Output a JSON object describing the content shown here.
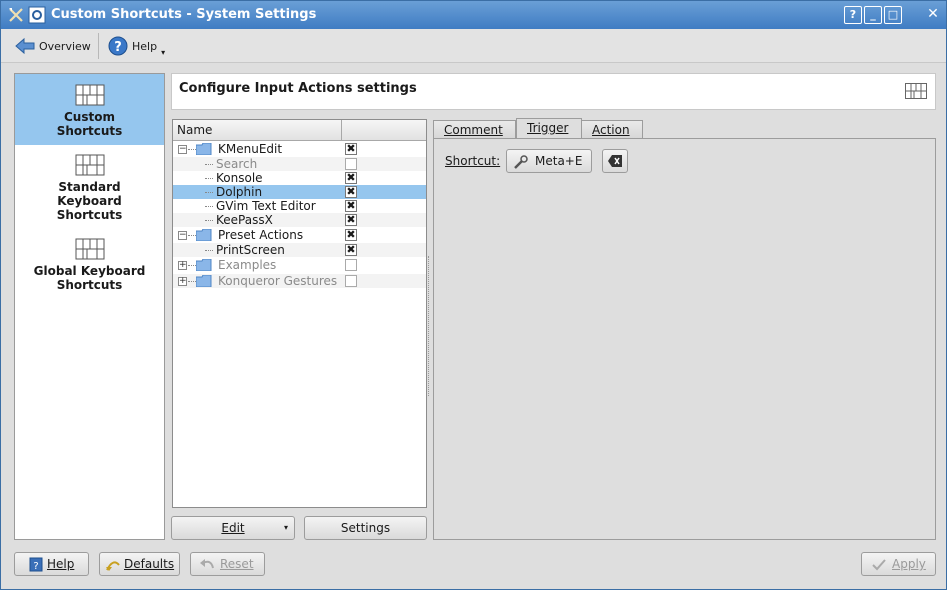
{
  "window": {
    "title": "Custom Shortcuts - System Settings"
  },
  "titlebar_buttons": [
    "?",
    "_",
    "□",
    "✕"
  ],
  "toolbar": {
    "overview_label": "Overview",
    "help_label": "Help"
  },
  "sidebar": {
    "items": [
      {
        "line1": "Custom",
        "line2": "Shortcuts",
        "line3": ""
      },
      {
        "line1": "Standard",
        "line2": "Keyboard",
        "line3": "Shortcuts"
      },
      {
        "line1": "Global Keyboard",
        "line2": "Shortcuts",
        "line3": ""
      }
    ]
  },
  "header": {
    "title": "Configure Input Actions settings"
  },
  "tree": {
    "column_name": "Name",
    "rows": [
      {
        "label": "KMenuEdit",
        "checked": true,
        "type": "group",
        "expanded": true,
        "disabled": false
      },
      {
        "label": "Search",
        "checked": false,
        "type": "item",
        "disabled": true
      },
      {
        "label": "Konsole",
        "checked": true,
        "type": "item",
        "disabled": false
      },
      {
        "label": "Dolphin",
        "checked": true,
        "type": "item",
        "disabled": false,
        "selected": true
      },
      {
        "label": "GVim Text Editor",
        "checked": true,
        "type": "item",
        "disabled": false
      },
      {
        "label": "KeePassX",
        "checked": true,
        "type": "item",
        "disabled": false
      },
      {
        "label": "Preset Actions",
        "checked": true,
        "type": "group",
        "expanded": true,
        "disabled": false
      },
      {
        "label": "PrintScreen",
        "checked": true,
        "type": "item",
        "disabled": false
      },
      {
        "label": "Examples",
        "checked": false,
        "type": "group",
        "expanded": false,
        "disabled": true
      },
      {
        "label": "Konqueror Gestures",
        "checked": false,
        "type": "group",
        "expanded": false,
        "disabled": true
      }
    ]
  },
  "tree_buttons": {
    "edit_label": "Edit",
    "settings_label": "Settings"
  },
  "tabs": [
    {
      "label": "Comment"
    },
    {
      "label": "Trigger"
    },
    {
      "label": "Action"
    }
  ],
  "trigger": {
    "shortcut_label": "Shortcut:",
    "shortcut_value": "Meta+E"
  },
  "footer": {
    "help_label": "Help",
    "defaults_label": "Defaults",
    "reset_label": "Reset",
    "apply_label": "Apply"
  },
  "colors": {
    "titlebar": "#4a86c8",
    "selection": "#95c6ee"
  }
}
